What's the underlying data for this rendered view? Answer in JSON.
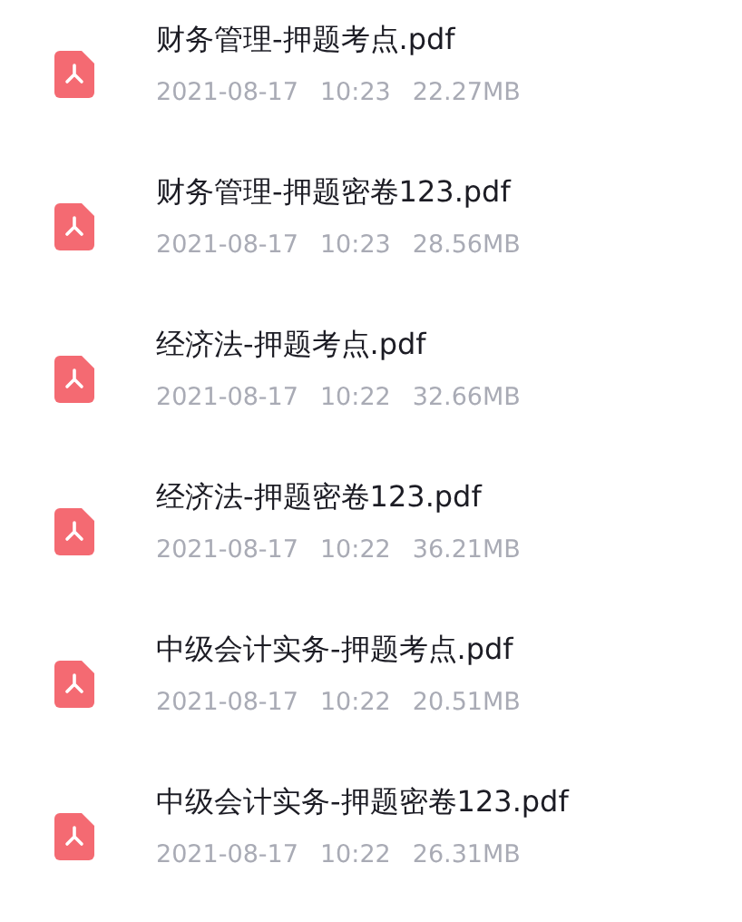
{
  "files": [
    {
      "name": "财务管理-押题考点.pdf",
      "date": "2021-08-17",
      "time": "10:23",
      "size": "22.27MB"
    },
    {
      "name": "财务管理-押题密卷123.pdf",
      "date": "2021-08-17",
      "time": "10:23",
      "size": "28.56MB"
    },
    {
      "name": "经济法-押题考点.pdf",
      "date": "2021-08-17",
      "time": "10:22",
      "size": "32.66MB"
    },
    {
      "name": "经济法-押题密卷123.pdf",
      "date": "2021-08-17",
      "time": "10:22",
      "size": "36.21MB"
    },
    {
      "name": "中级会计实务-押题考点.pdf",
      "date": "2021-08-17",
      "time": "10:22",
      "size": "20.51MB"
    },
    {
      "name": "中级会计实务-押题密卷123.pdf",
      "date": "2021-08-17",
      "time": "10:22",
      "size": "26.31MB"
    }
  ]
}
